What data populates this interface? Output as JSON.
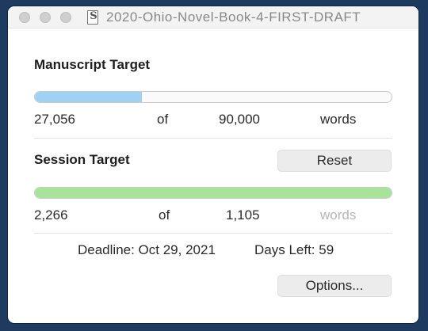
{
  "window": {
    "title": "2020-Ohio-Novel-Book-4-FIRST-DRAFT",
    "doc_icon_glyph": "S"
  },
  "manuscript": {
    "heading": "Manuscript Target",
    "current": "27,056",
    "of_label": "of",
    "target": "90,000",
    "unit": "words",
    "progress": 0.3
  },
  "session": {
    "heading": "Session Target",
    "reset_label": "Reset",
    "current": "2,266",
    "of_label": "of",
    "target": "1,105",
    "unit": "words",
    "progress": 1.0
  },
  "footer": {
    "deadline": "Deadline: Oct 29, 2021",
    "days_left": "Days Left: 59",
    "options_label": "Options..."
  },
  "colors": {
    "manuscript_bar": "#9fd2f2",
    "session_bar": "#a8e39a"
  }
}
